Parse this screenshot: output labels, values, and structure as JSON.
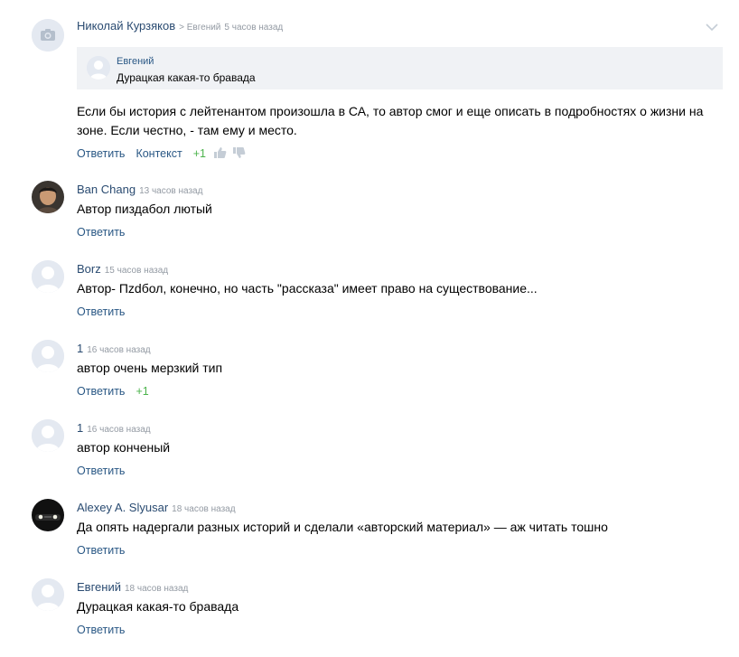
{
  "comments": [
    {
      "author": "Николай Курзяков",
      "reply_to": "> Евгений",
      "time": "5 часов назад",
      "quote": {
        "author": "Евгений",
        "text": "Дурацкая какая-то бравада"
      },
      "text": "Если бы история с лейтенантом произошла в СА, то автор смог и еще описать в подробностях о жизни на зоне. Если честно, - там ему и место.",
      "actions": {
        "reply": "Ответить",
        "context": "Контекст",
        "rating": "+1"
      }
    },
    {
      "author": "Ban Chang",
      "time": "13 часов назад",
      "text": "Автор пиздабол лютый",
      "actions": {
        "reply": "Ответить"
      }
    },
    {
      "author": "Borz",
      "time": "15 часов назад",
      "text": "Автор- Пzdбол, конечно, но часть \"рассказа\" имеет право на существование...",
      "actions": {
        "reply": "Ответить"
      }
    },
    {
      "author": "1",
      "time": "16 часов назад",
      "text": "автор очень мерзкий тип",
      "actions": {
        "reply": "Ответить",
        "rating": "+1"
      }
    },
    {
      "author": "1",
      "time": "16 часов назад",
      "text": "автор конченый",
      "actions": {
        "reply": "Ответить"
      }
    },
    {
      "author": "Alexey A. Slyusar",
      "time": "18 часов назад",
      "text": "Да опять надергали разных историй и сделали «авторский материал» — аж читать тошно",
      "actions": {
        "reply": "Ответить"
      }
    },
    {
      "author": "Евгений",
      "time": "18 часов назад",
      "text": "Дурацкая какая-то бравада",
      "actions": {
        "reply": "Ответить"
      }
    }
  ],
  "icons": {
    "avatar_default": "person-silhouette-icon",
    "avatar_camera": "camera-icon",
    "like": "thumbs-up-icon",
    "dislike": "thumbs-down-icon",
    "menu": "chevron-down-icon"
  },
  "colors": {
    "link": "#2a5885",
    "author": "#2a4b71",
    "muted": "#939aa3",
    "positive": "#4bb34b",
    "quote_bg": "#f0f2f5"
  }
}
